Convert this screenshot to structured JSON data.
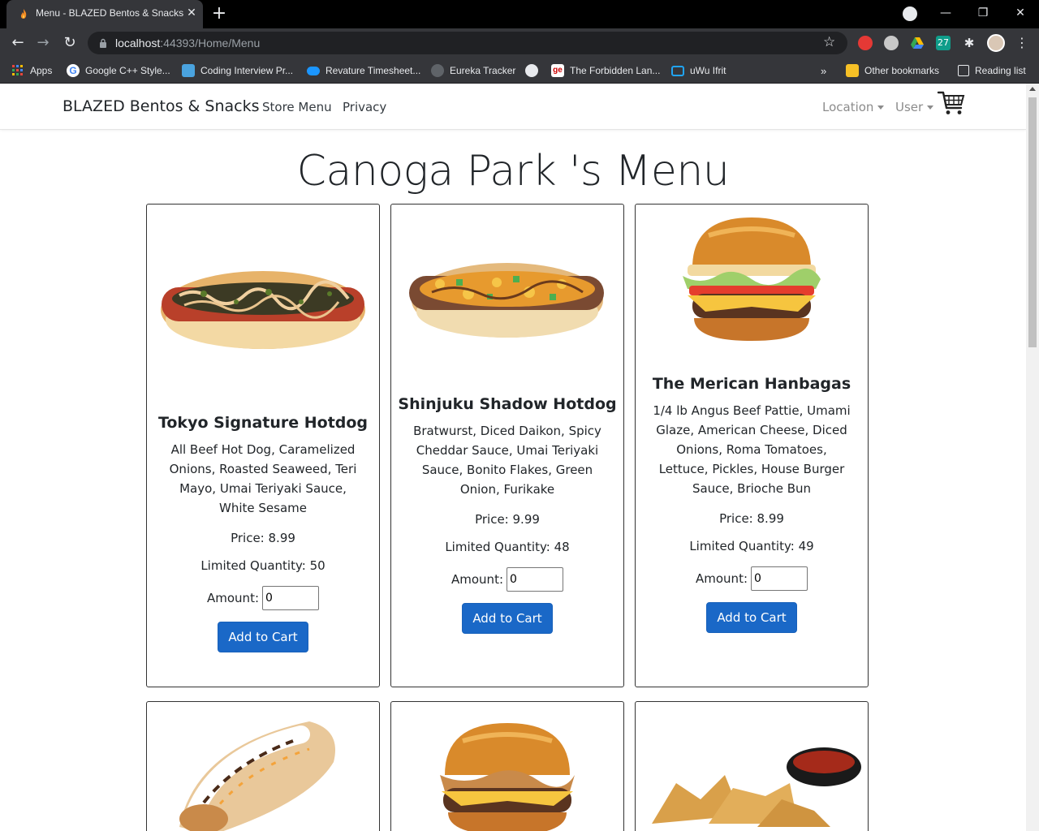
{
  "browser": {
    "tab_title": "Menu - BLAZED Bentos & Snacks",
    "tab_close": "✕",
    "new_tab": "+",
    "url_host": "localhost",
    "url_path": ":44393/Home/Menu",
    "window_controls": {
      "minimize": "—",
      "restore": "❐",
      "close": "✕"
    },
    "bookmarks": [
      {
        "label": "Apps",
        "icon": "apps-grid-icon",
        "color": "#e8453c"
      },
      {
        "label": "Google C++ Style...",
        "icon": "google-icon",
        "color": "#ffffff"
      },
      {
        "label": "Coding Interview Pr...",
        "icon": "book-icon",
        "color": "#4aa3df"
      },
      {
        "label": "Revature Timesheet...",
        "icon": "salesforce-cloud-icon",
        "color": "#1b96ff"
      },
      {
        "label": "Eureka Tracker",
        "icon": "eureka-icon",
        "color": "#5f6368"
      },
      {
        "label": "",
        "icon": "globe-icon",
        "color": "#e8eaed"
      },
      {
        "label": "The Forbidden Lan...",
        "icon": "ge-icon",
        "color": "#ffffff"
      },
      {
        "label": "uWu Ifrit",
        "icon": "tv-icon",
        "color": "#20a4f3"
      }
    ],
    "more_bookmarks": "»",
    "other_bookmarks": "Other bookmarks",
    "reading_list": "Reading list"
  },
  "site": {
    "brand": "BLAZED Bentos & Snacks",
    "nav": {
      "store_menu": "Store Menu",
      "privacy": "Privacy",
      "location": "Location",
      "user": "User"
    },
    "page_title": "Canoga Park 's Menu",
    "amount_label": "Amount:",
    "add_to_cart": "Add to Cart"
  },
  "products": [
    {
      "name": "Tokyo Signature Hotdog",
      "description": "All Beef Hot Dog, Caramelized Onions, Roasted Seaweed, Teri Mayo, Umai Teriyaki Sauce, White Sesame",
      "price": "Price: 8.99",
      "quantity": "Limited Quantity: 50",
      "amount": "0",
      "image": "hotdog-seaweed"
    },
    {
      "name": "Shinjuku Shadow Hotdog",
      "description": "Bratwurst, Diced Daikon, Spicy Cheddar Sauce, Umai Teriyaki Sauce, Bonito Flakes, Green Onion, Furikake",
      "price": "Price: 9.99",
      "quantity": "Limited Quantity: 48",
      "amount": "0",
      "image": "hotdog-cheddar"
    },
    {
      "name": "The Merican Hanbagas",
      "description": "1/4 lb Angus Beef Pattie, Umami Glaze, American Cheese, Diced Onions, Roma Tomatoes, Lettuce, Pickles, House Burger Sauce, Brioche Bun",
      "price": "Price: 8.99",
      "quantity": "Limited Quantity: 49",
      "amount": "0",
      "image": "burger-classic"
    },
    {
      "image": "dessert-hotdog"
    },
    {
      "image": "burger-slaw"
    },
    {
      "image": "fried-wontons"
    }
  ]
}
